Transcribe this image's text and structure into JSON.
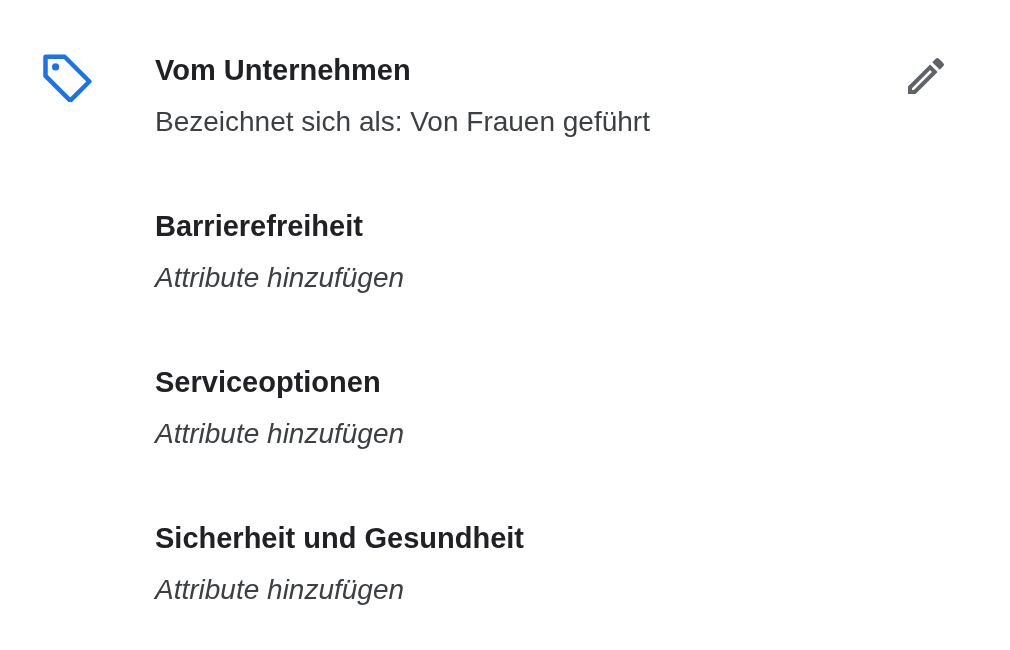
{
  "attributes": [
    {
      "title": "Vom Unternehmen",
      "value": "Bezeichnet sich als: Von Frauen geführt",
      "kind": "value"
    },
    {
      "title": "Barrierefreiheit",
      "value": "Attribute hinzufügen",
      "kind": "empty"
    },
    {
      "title": "Serviceoptionen",
      "value": "Attribute hinzufügen",
      "kind": "empty"
    },
    {
      "title": "Sicherheit und Gesundheit",
      "value": "Attribute hinzufügen",
      "kind": "empty"
    }
  ]
}
